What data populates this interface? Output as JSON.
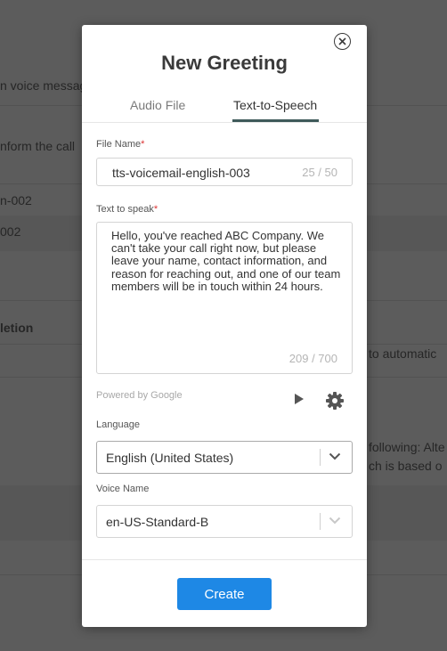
{
  "background": {
    "text_1": "n voice messag",
    "text_2": "nform the call",
    "text_3": "n-002",
    "text_4": "002",
    "text_5": "letion",
    "text_6": "to automatic",
    "text_7": "following: Alte",
    "text_8": "ch is based o"
  },
  "modal": {
    "title": "New Greeting",
    "tabs": [
      {
        "label": "Audio File",
        "active": false
      },
      {
        "label": "Text-to-Speech",
        "active": true
      }
    ],
    "file_name": {
      "label": "File Name",
      "required_mark": "*",
      "value": "tts-voicemail-english-003",
      "counter": "25 / 50"
    },
    "text_to_speak": {
      "label": "Text to speak",
      "required_mark": "*",
      "value": "Hello, you've reached ABC Company. We can't take your call right now, but please leave your name, contact information, and reason for reaching out, and one of our team members will be in touch within 24 hours.",
      "counter": "209 / 700"
    },
    "powered_by": "Powered by Google",
    "language": {
      "label": "Language",
      "value": "English (United States)"
    },
    "voice_name": {
      "label": "Voice Name",
      "value": "en-US-Standard-B"
    },
    "create_label": "Create"
  },
  "colors": {
    "accent": "#1e88e5",
    "tab_underline": "#3f5a5a",
    "required": "#dd3333",
    "overlay": "#5c5c5c"
  },
  "icons": [
    "close-icon",
    "play-icon",
    "gear-icon",
    "chevron-down-icon"
  ]
}
